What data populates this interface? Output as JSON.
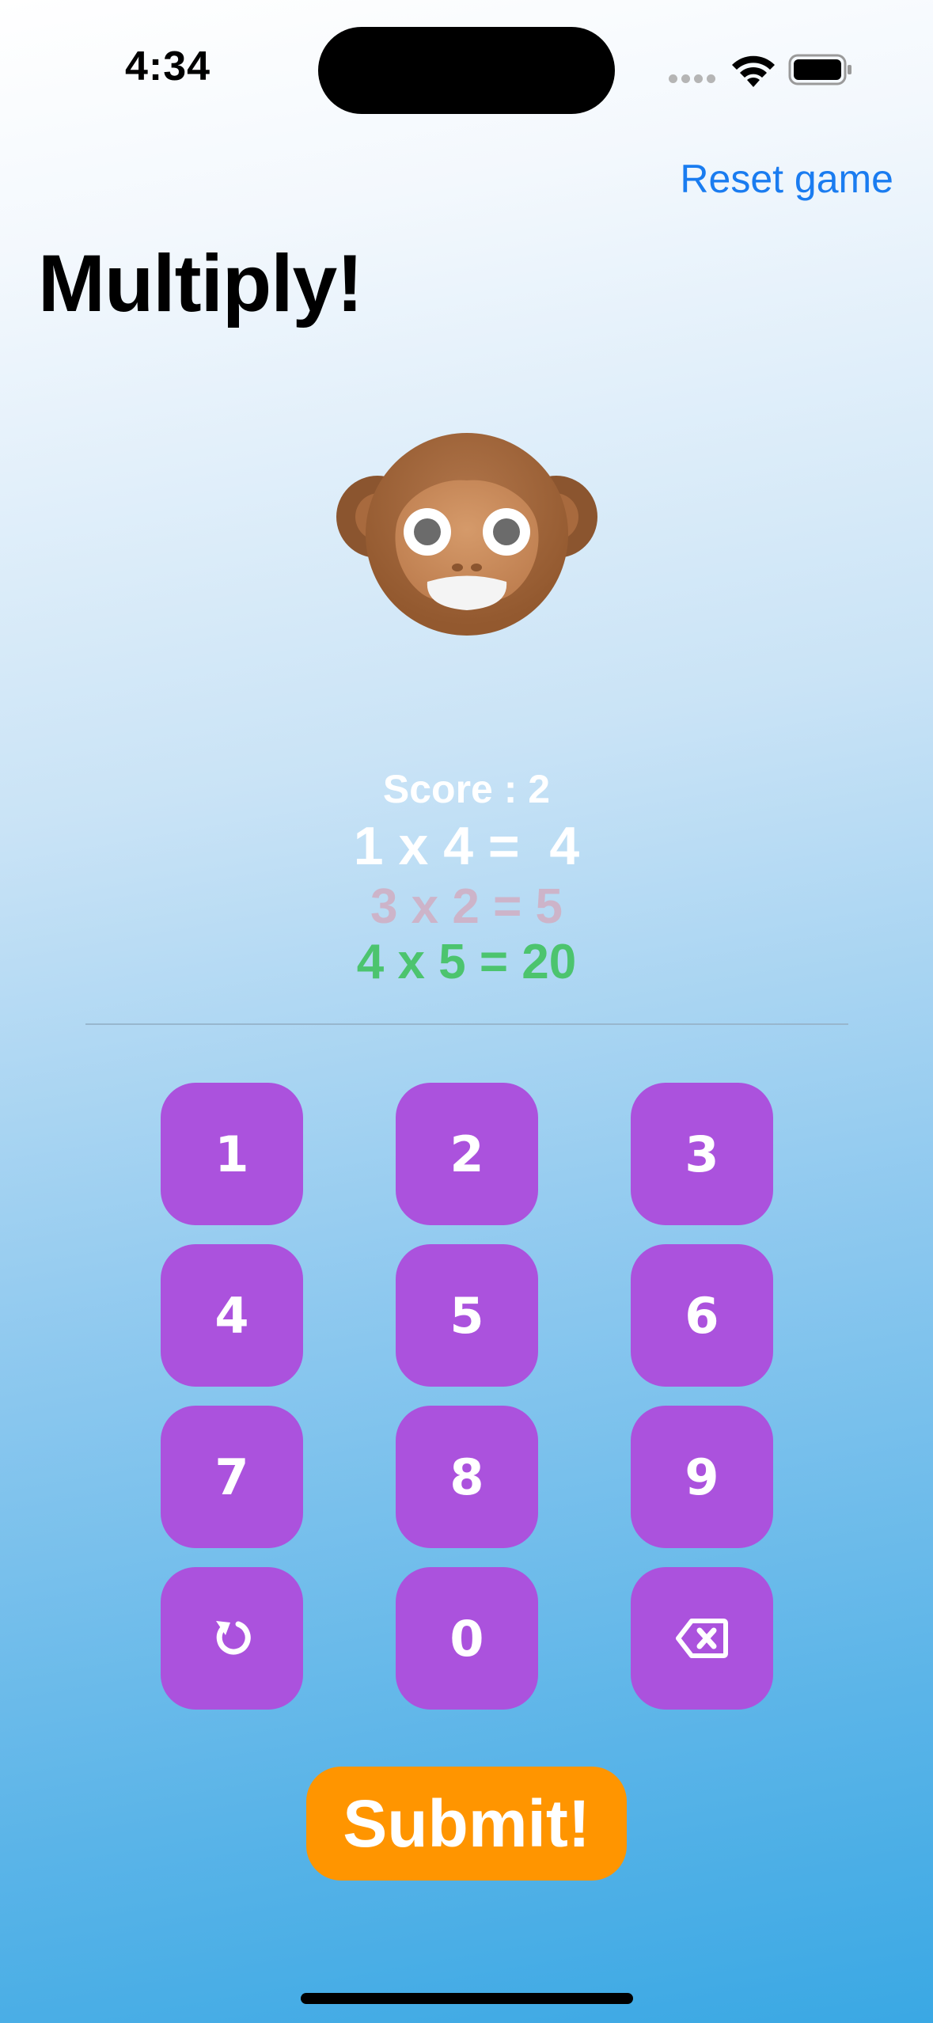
{
  "status_bar": {
    "time": "4:34"
  },
  "header": {
    "reset_label": "Reset game",
    "title": "Multiply!"
  },
  "game": {
    "score_text": "Score : 2",
    "current_question": "1 x 4 =  4",
    "history": [
      {
        "text": "3 x 2 = 5",
        "result": "wrong",
        "color": "#cdb4c9"
      },
      {
        "text": "4 x 5 = 20",
        "result": "correct",
        "color": "#4cc46e"
      }
    ]
  },
  "keypad": {
    "keys": [
      "1",
      "2",
      "3",
      "4",
      "5",
      "6",
      "7",
      "8",
      "9",
      "",
      "0",
      ""
    ],
    "icons": {
      "reset": "reset-arrow-icon",
      "delete": "delete-backspace-icon"
    }
  },
  "submit_label": "Submit!",
  "colors": {
    "key_background": "#ab52dd",
    "submit_background": "#ff9500",
    "link": "#1a7cf0"
  }
}
